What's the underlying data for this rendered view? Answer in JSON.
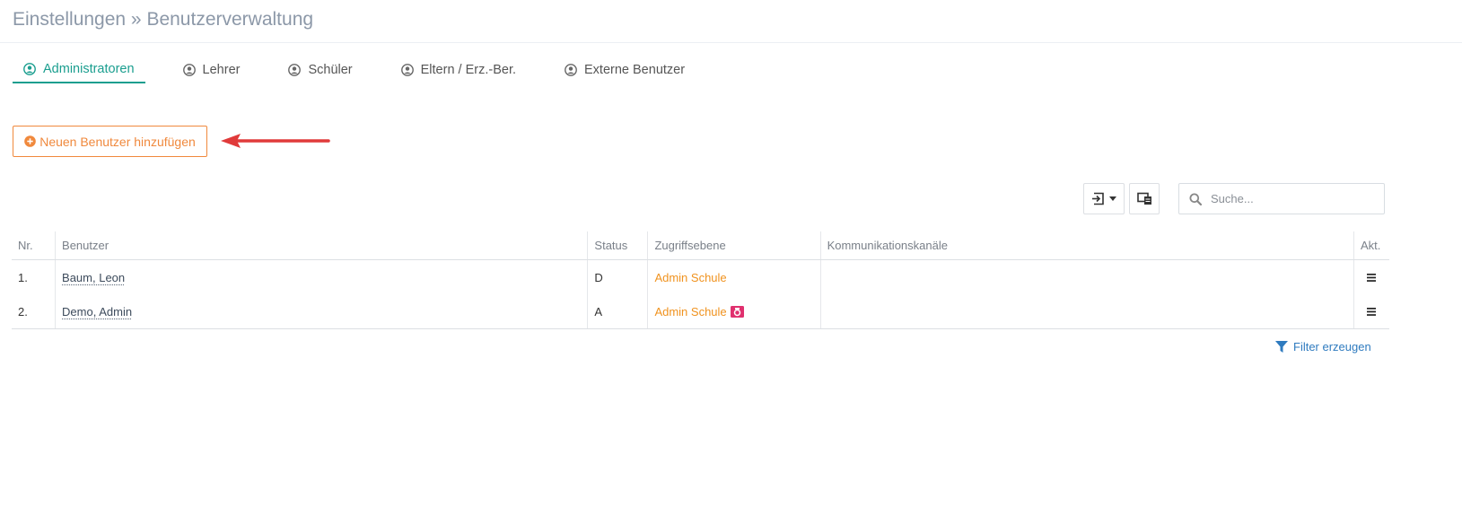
{
  "header": {
    "title": "Einstellungen » Benutzerverwaltung"
  },
  "tabs": [
    {
      "label": "Administratoren",
      "icon": "user-circle-icon",
      "active": true
    },
    {
      "label": "Lehrer",
      "icon": "user-circle-icon",
      "active": false
    },
    {
      "label": "Schüler",
      "icon": "user-circle-icon",
      "active": false
    },
    {
      "label": "Eltern / Erz.-Ber.",
      "icon": "user-circle-icon",
      "active": false
    },
    {
      "label": "Externe Benutzer",
      "icon": "user-circle-icon",
      "active": false
    }
  ],
  "add_button": {
    "label": "Neuen Benutzer hinzufügen",
    "icon": "plus-circle-icon"
  },
  "toolbar": {
    "export_icon": "export-icon",
    "dropdown_icon": "caret-down-icon",
    "columns_icon": "columns-toggle-icon"
  },
  "search": {
    "placeholder": "Suche...",
    "value": ""
  },
  "table": {
    "headers": [
      "Nr.",
      "Benutzer",
      "Status",
      "Zugriffsebene",
      "Kommunikationskanäle",
      "Akt."
    ],
    "rows": [
      {
        "nr": "1.",
        "user": "Baum, Leon",
        "status": "D",
        "access": "Admin Schule",
        "camera": false,
        "channels": ""
      },
      {
        "nr": "2.",
        "user": "Demo, Admin",
        "status": "A",
        "access": "Admin Schule",
        "camera": true,
        "channels": ""
      }
    ]
  },
  "filter": {
    "label": "Filter erzeugen",
    "icon": "funnel-icon"
  },
  "colors": {
    "accent": "#1a9e8f",
    "orange": "#f0893d",
    "arrow": "#e03a3a",
    "status_d": "#1e8a1e",
    "status_a": "#c0262c",
    "camera": "#e0306e",
    "link": "#2f7bbf"
  }
}
